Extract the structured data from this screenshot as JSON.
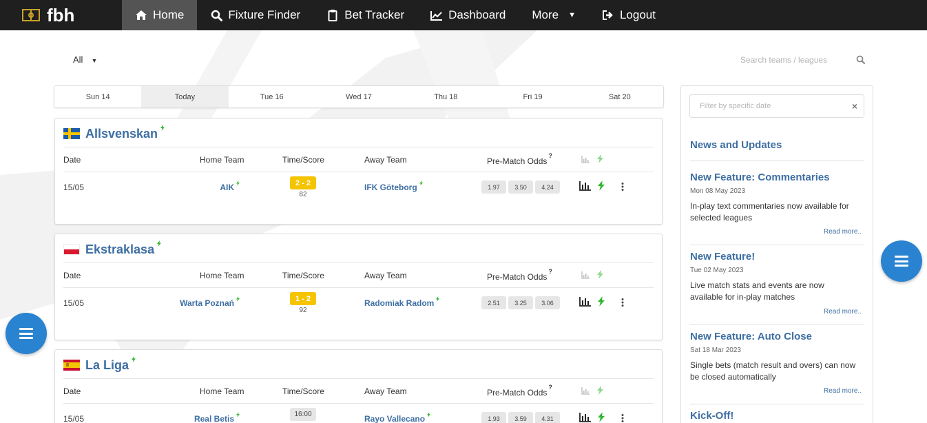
{
  "nav": {
    "logo": "fbh",
    "items": [
      {
        "label": "Home",
        "icon": "home-icon",
        "active": true
      },
      {
        "label": "Fixture Finder",
        "icon": "search-icon"
      },
      {
        "label": "Bet Tracker",
        "icon": "clipboard-icon"
      },
      {
        "label": "Dashboard",
        "icon": "chart-icon"
      },
      {
        "label": "More",
        "icon": "caret-down-icon"
      },
      {
        "label": "Logout",
        "icon": "logout-icon"
      }
    ]
  },
  "filter": {
    "league_select": "All",
    "search_placeholder": "Search teams / leagues"
  },
  "date_tabs": [
    "Sun 14",
    "Today",
    "Tue 16",
    "Wed 17",
    "Thu 18",
    "Fri 19",
    "Sat 20"
  ],
  "selected_date_tab": "Today",
  "columns": {
    "date": "Date",
    "home": "Home Team",
    "time": "Time/Score",
    "away": "Away Team",
    "odds": "Pre-Match Odds",
    "odds_help": "?"
  },
  "leagues": [
    {
      "name": "Allsvenskan",
      "flag": "sweden",
      "match": {
        "date": "15/05",
        "home": "AIK",
        "score": "2 - 2",
        "minute": "82",
        "away": "IFK Göteborg",
        "odds": [
          "1.97",
          "3.50",
          "4.24"
        ]
      }
    },
    {
      "name": "Ekstraklasa",
      "flag": "poland",
      "match": {
        "date": "15/05",
        "home": "Warta Poznań",
        "score": "1 - 2",
        "minute": "92",
        "away": "Radomiak Radom",
        "odds": [
          "2.51",
          "3.25",
          "3.06"
        ]
      }
    },
    {
      "name": "La Liga",
      "flag": "spain",
      "match": {
        "date": "15/05",
        "home": "Real Betis",
        "time": "16:00",
        "away": "Rayo Vallecano",
        "odds": [
          "1.93",
          "3.59",
          "4.31"
        ]
      }
    }
  ],
  "side": {
    "filter_placeholder": "Filter by specific date",
    "clear": "×",
    "news_title": "News and Updates",
    "news": [
      {
        "title": "New Feature: Commentaries",
        "date": "Mon 08 May 2023",
        "body": "In-play text commentaries now available for selected leagues",
        "more": "Read more.."
      },
      {
        "title": "New Feature!",
        "date": "Tue 02 May 2023",
        "body": "Live match stats and events are now available for in-play matches",
        "more": "Read more.."
      },
      {
        "title": "New Feature: Auto Close",
        "date": "Sat 18 Mar 2023",
        "body": "Single bets (match result and overs) can now be closed automatically",
        "more": "Read more.."
      },
      {
        "title": "Kick-Off!"
      }
    ]
  },
  "colors": {
    "nav_bg": "#1f1f1f",
    "accent_blue": "#3e6fa3",
    "score_yellow": "#f5c400",
    "live_green": "#2fb52f",
    "fab_blue": "#2a83d0"
  }
}
